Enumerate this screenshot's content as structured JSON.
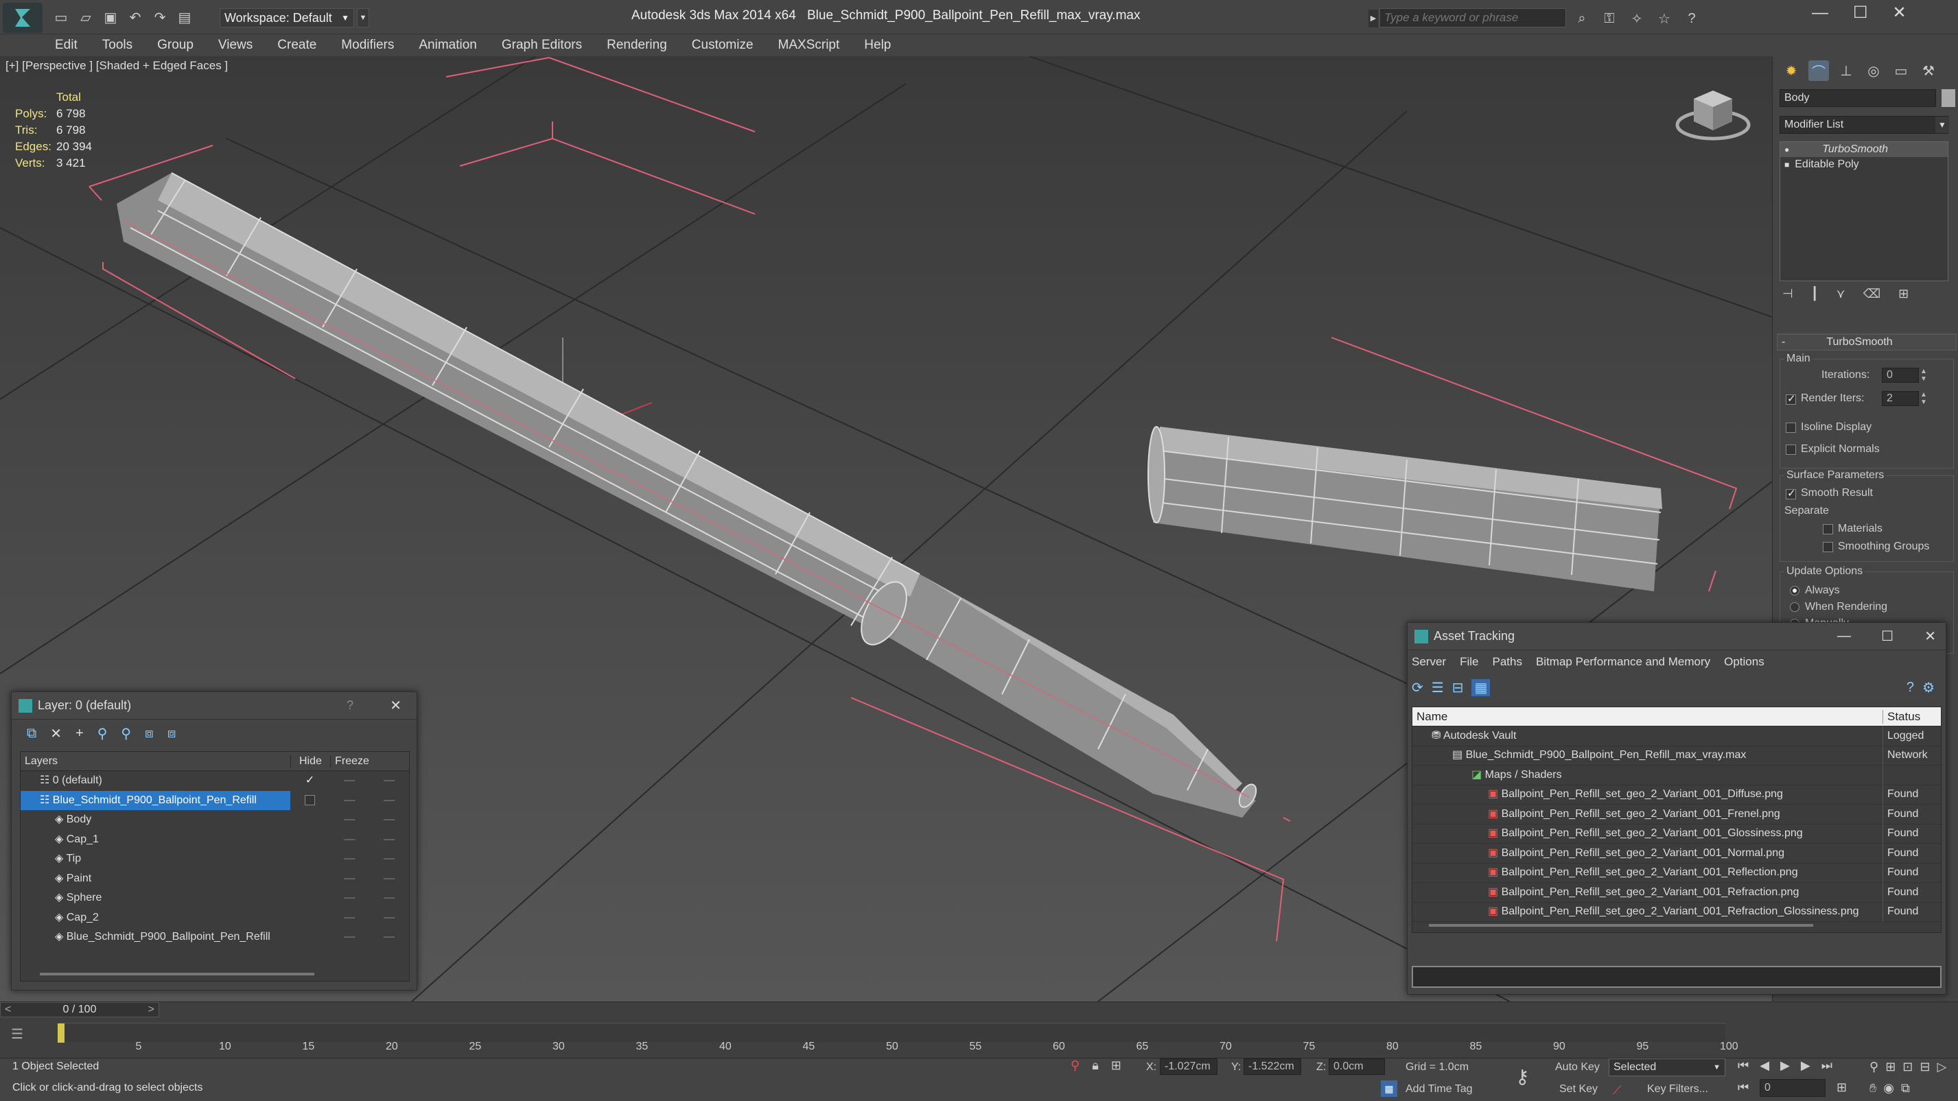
{
  "app": {
    "title": "Autodesk 3ds Max  2014 x64",
    "file": "Blue_Schmidt_P900_Ballpoint_Pen_Refill_max_vray.max",
    "workspace": "Workspace: Default",
    "search_placeholder": "Type a keyword or phrase"
  },
  "menu": [
    "Edit",
    "Tools",
    "Group",
    "Views",
    "Create",
    "Modifiers",
    "Animation",
    "Graph Editors",
    "Rendering",
    "Customize",
    "MAXScript",
    "Help"
  ],
  "viewport": {
    "label": "[+] [Perspective ] [Shaded + Edged Faces ]",
    "stats": {
      "total_label": "Total",
      "polys_label": "Polys:",
      "polys": "6 798",
      "tris_label": "Tris:",
      "tris": "6 798",
      "edges_label": "Edges:",
      "edges": "20 394",
      "verts_label": "Verts:",
      "verts": "3 421"
    }
  },
  "command_panel": {
    "object_name": "Body",
    "modifier_list": "Modifier List",
    "stack": [
      "TurboSmooth",
      "Editable Poly"
    ],
    "rollout_title": "TurboSmooth",
    "main_label": "Main",
    "iterations_label": "Iterations:",
    "iterations": "0",
    "render_iters_label": "Render Iters:",
    "render_iters": "2",
    "isoline": "Isoline Display",
    "explicit_normals": "Explicit Normals",
    "surface_params": "Surface Parameters",
    "smooth_result": "Smooth Result",
    "separate": "Separate",
    "materials": "Materials",
    "smoothing_groups": "Smoothing Groups",
    "update_options": "Update Options",
    "always": "Always",
    "when_rendering": "When Rendering",
    "manually": "Manually"
  },
  "layer_window": {
    "title": "Layer: 0 (default)",
    "help": "?",
    "col_layers": "Layers",
    "col_hide": "Hide",
    "col_freeze": "Freeze",
    "rows": [
      "0 (default)",
      "Blue_Schmidt_P900_Ballpoint_Pen_Refill",
      "Body",
      "Cap_1",
      "Tip",
      "Paint",
      "Sphere",
      "Cap_2",
      "Blue_Schmidt_P900_Ballpoint_Pen_Refill"
    ]
  },
  "asset_window": {
    "title": "Asset Tracking",
    "menu": [
      "Server",
      "File",
      "Paths",
      "Bitmap Performance and Memory",
      "Options"
    ],
    "col_name": "Name",
    "col_status": "Status",
    "rows": [
      {
        "name": "Autodesk Vault",
        "status": "Logged"
      },
      {
        "name": "Blue_Schmidt_P900_Ballpoint_Pen_Refill_max_vray.max",
        "status": "Network"
      },
      {
        "name": "Maps / Shaders",
        "status": ""
      },
      {
        "name": "Ballpoint_Pen_Refill_set_geo_2_Variant_001_Diffuse.png",
        "status": "Found"
      },
      {
        "name": "Ballpoint_Pen_Refill_set_geo_2_Variant_001_Frenel.png",
        "status": "Found"
      },
      {
        "name": "Ballpoint_Pen_Refill_set_geo_2_Variant_001_Glossiness.png",
        "status": "Found"
      },
      {
        "name": "Ballpoint_Pen_Refill_set_geo_2_Variant_001_Normal.png",
        "status": "Found"
      },
      {
        "name": "Ballpoint_Pen_Refill_set_geo_2_Variant_001_Reflection.png",
        "status": "Found"
      },
      {
        "name": "Ballpoint_Pen_Refill_set_geo_2_Variant_001_Refraction.png",
        "status": "Found"
      },
      {
        "name": "Ballpoint_Pen_Refill_set_geo_2_Variant_001_Refraction_Glossiness.png",
        "status": "Found"
      }
    ]
  },
  "timeline": {
    "frame": "0 / 100",
    "ticks": [
      "5",
      "10",
      "15",
      "20",
      "25",
      "30",
      "35",
      "40",
      "45",
      "50",
      "55",
      "60",
      "65",
      "70",
      "75",
      "80",
      "85",
      "90",
      "95",
      "100"
    ]
  },
  "status": {
    "selected": "1 Object Selected",
    "hint": "Click or click-and-drag to select objects",
    "x_label": "X:",
    "x": "-1.027cm",
    "y_label": "Y:",
    "y": "-1.522cm",
    "z_label": "Z:",
    "z": "0.0cm",
    "grid": "Grid = 1.0cm",
    "add_time_tag": "Add Time Tag",
    "auto_key": "Auto Key",
    "set_key": "Set Key",
    "selected_dd": "Selected",
    "key_filters": "Key Filters...",
    "frame_field": "0"
  }
}
